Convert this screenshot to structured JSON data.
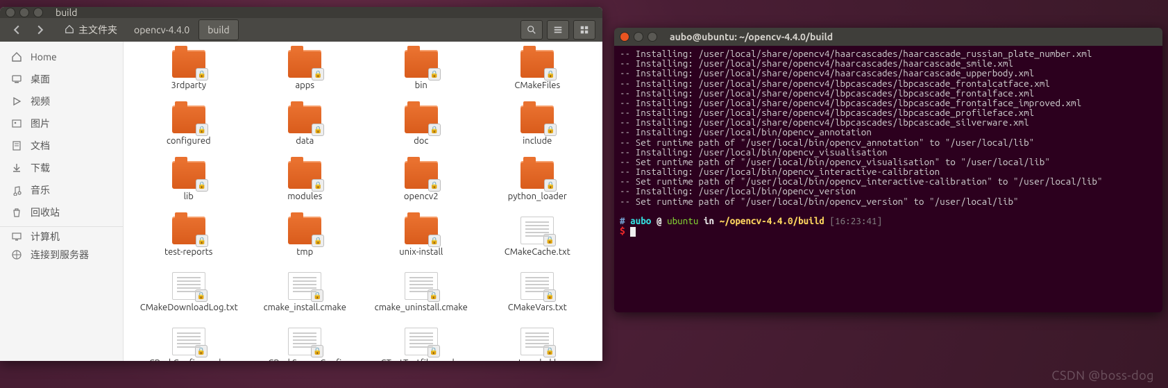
{
  "fm": {
    "title": "build",
    "breadcrumb": {
      "home": "主文件夹",
      "p1": "opencv-4.4.0",
      "p2": "build"
    },
    "sidebar": [
      {
        "icon": "home",
        "label": "Home"
      },
      {
        "icon": "desktop",
        "label": "桌面"
      },
      {
        "icon": "videos",
        "label": "视频"
      },
      {
        "icon": "pictures",
        "label": "图片"
      },
      {
        "icon": "documents",
        "label": "文档"
      },
      {
        "icon": "downloads",
        "label": "下载"
      },
      {
        "icon": "music",
        "label": "音乐"
      },
      {
        "icon": "trash",
        "label": "回收站"
      },
      {
        "icon": "computer",
        "label": "计算机",
        "sep": true
      },
      {
        "icon": "network",
        "label": "连接到服务器"
      }
    ],
    "items": [
      {
        "type": "folder",
        "name": "3rdparty"
      },
      {
        "type": "folder",
        "name": "apps"
      },
      {
        "type": "folder",
        "name": "bin"
      },
      {
        "type": "folder",
        "name": "CMakeFiles"
      },
      {
        "type": "folder",
        "name": "configured"
      },
      {
        "type": "folder",
        "name": "data"
      },
      {
        "type": "folder",
        "name": "doc"
      },
      {
        "type": "folder",
        "name": "include"
      },
      {
        "type": "folder",
        "name": "lib"
      },
      {
        "type": "folder",
        "name": "modules"
      },
      {
        "type": "folder",
        "name": "opencv2"
      },
      {
        "type": "folder",
        "name": "python_loader"
      },
      {
        "type": "folder",
        "name": "test-reports"
      },
      {
        "type": "folder",
        "name": "tmp"
      },
      {
        "type": "folder",
        "name": "unix-install"
      },
      {
        "type": "file",
        "name": "CMakeCache.txt"
      },
      {
        "type": "file",
        "name": "CMakeDownloadLog.txt"
      },
      {
        "type": "file",
        "name": "cmake_install.cmake"
      },
      {
        "type": "file",
        "name": "cmake_uninstall.cmake"
      },
      {
        "type": "file",
        "name": "CMakeVars.txt"
      },
      {
        "type": "file",
        "name": "CPackConfig.cmake"
      },
      {
        "type": "file",
        "name": "CPackSourceConfi"
      },
      {
        "type": "file",
        "name": "CTestTestfile.cmake"
      },
      {
        "type": "file",
        "name": "custom_hal.hpp"
      }
    ]
  },
  "term": {
    "title": "aubo@ubuntu: ~/opencv-4.4.0/build",
    "lines": [
      "-- Installing: /user/local/share/opencv4/haarcascades/haarcascade_russian_plate_number.xml",
      "-- Installing: /user/local/share/opencv4/haarcascades/haarcascade_smile.xml",
      "-- Installing: /user/local/share/opencv4/haarcascades/haarcascade_upperbody.xml",
      "-- Installing: /user/local/share/opencv4/lbpcascades/lbpcascade_frontalcatface.xml",
      "-- Installing: /user/local/share/opencv4/lbpcascades/lbpcascade_frontalface.xml",
      "-- Installing: /user/local/share/opencv4/lbpcascades/lbpcascade_frontalface_improved.xml",
      "-- Installing: /user/local/share/opencv4/lbpcascades/lbpcascade_profileface.xml",
      "-- Installing: /user/local/share/opencv4/lbpcascades/lbpcascade_silverware.xml",
      "-- Installing: /user/local/bin/opencv_annotation",
      "-- Set runtime path of \"/user/local/bin/opencv_annotation\" to \"/user/local/lib\"",
      "-- Installing: /user/local/bin/opencv_visualisation",
      "-- Set runtime path of \"/user/local/bin/opencv_visualisation\" to \"/user/local/lib\"",
      "-- Installing: /user/local/bin/opencv_interactive-calibration",
      "-- Set runtime path of \"/user/local/bin/opencv_interactive-calibration\" to \"/user/local/lib\"",
      "-- Installing: /user/local/bin/opencv_version",
      "-- Set runtime path of \"/user/local/bin/opencv_version\" to \"/user/local/lib\""
    ],
    "prompt": {
      "hash": "#",
      "user": "aubo",
      "at": "@",
      "host": "ubuntu",
      "in_word": "in",
      "path": "~/opencv-4.4.0/build",
      "time": "[16:23:41]",
      "dollar": "$"
    }
  },
  "watermark": "CSDN @boss-dog"
}
